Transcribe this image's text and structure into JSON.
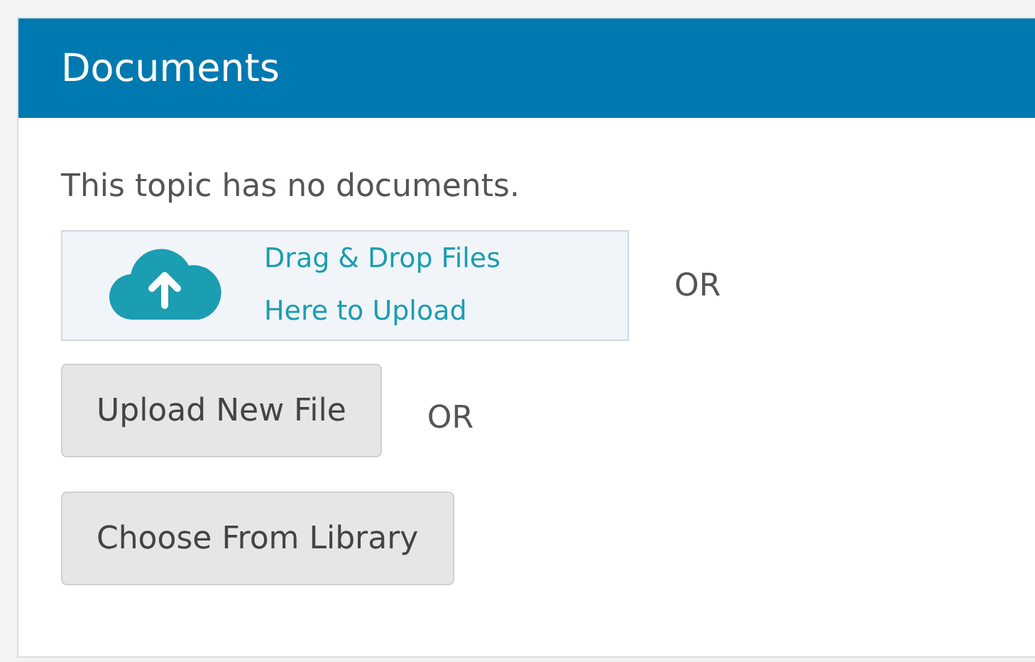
{
  "panel": {
    "title": "Documents"
  },
  "message": "This topic has no documents.",
  "dropzone": {
    "lines": [
      "Drag & Drop Files",
      "Here to Upload"
    ],
    "separator": "OR"
  },
  "buttons": [
    {
      "label": "Upload New File",
      "separator": "OR"
    },
    {
      "label": "Choose From Library"
    }
  ]
}
